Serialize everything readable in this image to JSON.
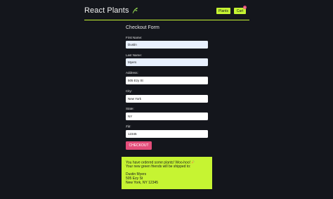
{
  "header": {
    "brand_title": "React Plants",
    "nav": {
      "plants_label": "Plants",
      "cart_label": "Cart",
      "cart_count": "1"
    }
  },
  "form": {
    "title": "Checkout Form",
    "fields": [
      {
        "label": "First Name:",
        "value": "Dustin"
      },
      {
        "label": "Last Name:",
        "value": "Myers"
      },
      {
        "label": "Address:",
        "value": "505 Ezy St"
      },
      {
        "label": "City:",
        "value": "New York"
      },
      {
        "label": "State:",
        "value": "NY"
      },
      {
        "label": "Zip:",
        "value": "12345"
      }
    ],
    "submit_label": "CHECKOUT"
  },
  "confirmation": {
    "line1": "You have ordered some plants! Woo-hoo!",
    "line2": "Your new green friends will be shipped to:",
    "name": "Dustin Myers",
    "street": "505 Ezy St",
    "city_state_zip": "New York, NY 12345"
  },
  "colors": {
    "background": "#14161c",
    "accent": "#c6f432",
    "button": "#e44d7a"
  },
  "icons": {
    "brand": "plant-leaf-icon",
    "celebration": "party-popper-icon"
  }
}
